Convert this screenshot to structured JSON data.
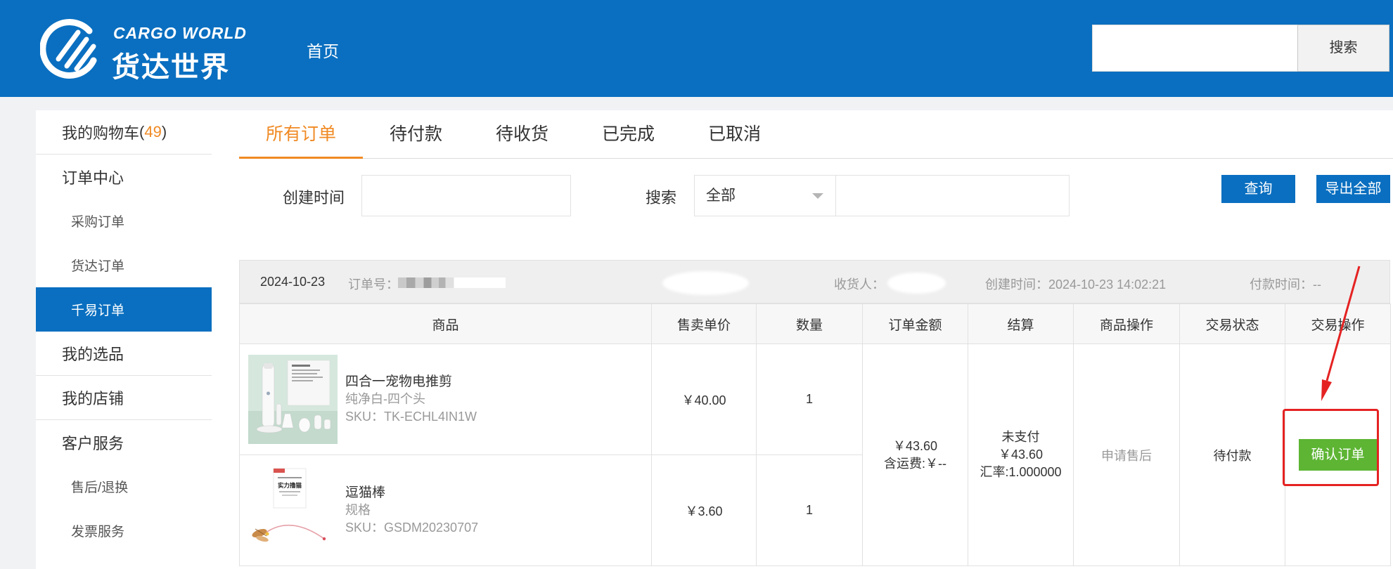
{
  "header": {
    "logo": {
      "en": "CARGO WORLD",
      "cn": "货达世界"
    },
    "nav": [
      {
        "label": "首页"
      }
    ],
    "search": {
      "value": "",
      "button_label": "搜索"
    }
  },
  "sidebar": {
    "cart": {
      "label": "我的购物车",
      "open": "(",
      "count": "49",
      "close": ")"
    },
    "items": [
      {
        "label": "订单中心",
        "group": true
      },
      {
        "label": "采购订单",
        "group": false
      },
      {
        "label": "货达订单",
        "group": false
      },
      {
        "label": "千易订单",
        "group": false,
        "active": true
      },
      {
        "label": "我的选品",
        "group": true
      },
      {
        "label": "我的店铺",
        "group": true
      },
      {
        "label": "客户服务",
        "group": true
      },
      {
        "label": "售后/退换",
        "group": false
      },
      {
        "label": "发票服务",
        "group": false
      }
    ]
  },
  "tabs": [
    {
      "label": "所有订单",
      "active": true
    },
    {
      "label": "待付款",
      "active": false
    },
    {
      "label": "待收货",
      "active": false
    },
    {
      "label": "已完成",
      "active": false
    },
    {
      "label": "已取消",
      "active": false
    }
  ],
  "filters": {
    "created_label": "创建时间",
    "created_value": "",
    "search_label": "搜索",
    "search_field_selected": "全部",
    "keyword_value": "",
    "query_button": "查询",
    "export_button": "导出全部"
  },
  "order": {
    "date": "2024-10-23",
    "order_no_label": "订单号：",
    "receiver_label": "收货人：",
    "created_time": "创建时间：2024-10-23 14:02:21",
    "paid_time": "付款时间：--"
  },
  "table": {
    "columns": [
      "商品",
      "售卖单价",
      "数量",
      "订单金额",
      "结算",
      "商品操作",
      "交易状态",
      "交易操作"
    ]
  },
  "items": [
    {
      "name": "四合一宠物电推剪",
      "spec": "纯净白-四个头",
      "sku": "SKU：TK-ECHL4IN1W",
      "price": "￥40.00",
      "qty": "1"
    },
    {
      "name": "逗猫棒",
      "spec": "规格",
      "sku": "SKU：GSDM20230707",
      "price": "￥3.60",
      "qty": "1",
      "image_text": "实力撸猫"
    }
  ],
  "summary": {
    "amount": "￥43.60",
    "shipping": "含运费:￥--",
    "settle_status": "未支付",
    "settle_amount": "￥43.60",
    "exchange_rate": "汇率:1.000000",
    "after_sale": "申请售后",
    "status": "待付款",
    "confirm_button": "确认订单"
  },
  "colors": {
    "brand_blue": "#0a6fc0",
    "accent_orange": "#f08a24",
    "confirm_green": "#5db533",
    "annotation_red": "#e52222"
  },
  "icons": {
    "logo": "cargo-world-emblem-icon",
    "select_caret": "caret-down-icon",
    "annotation": "red-arrow-icon"
  }
}
